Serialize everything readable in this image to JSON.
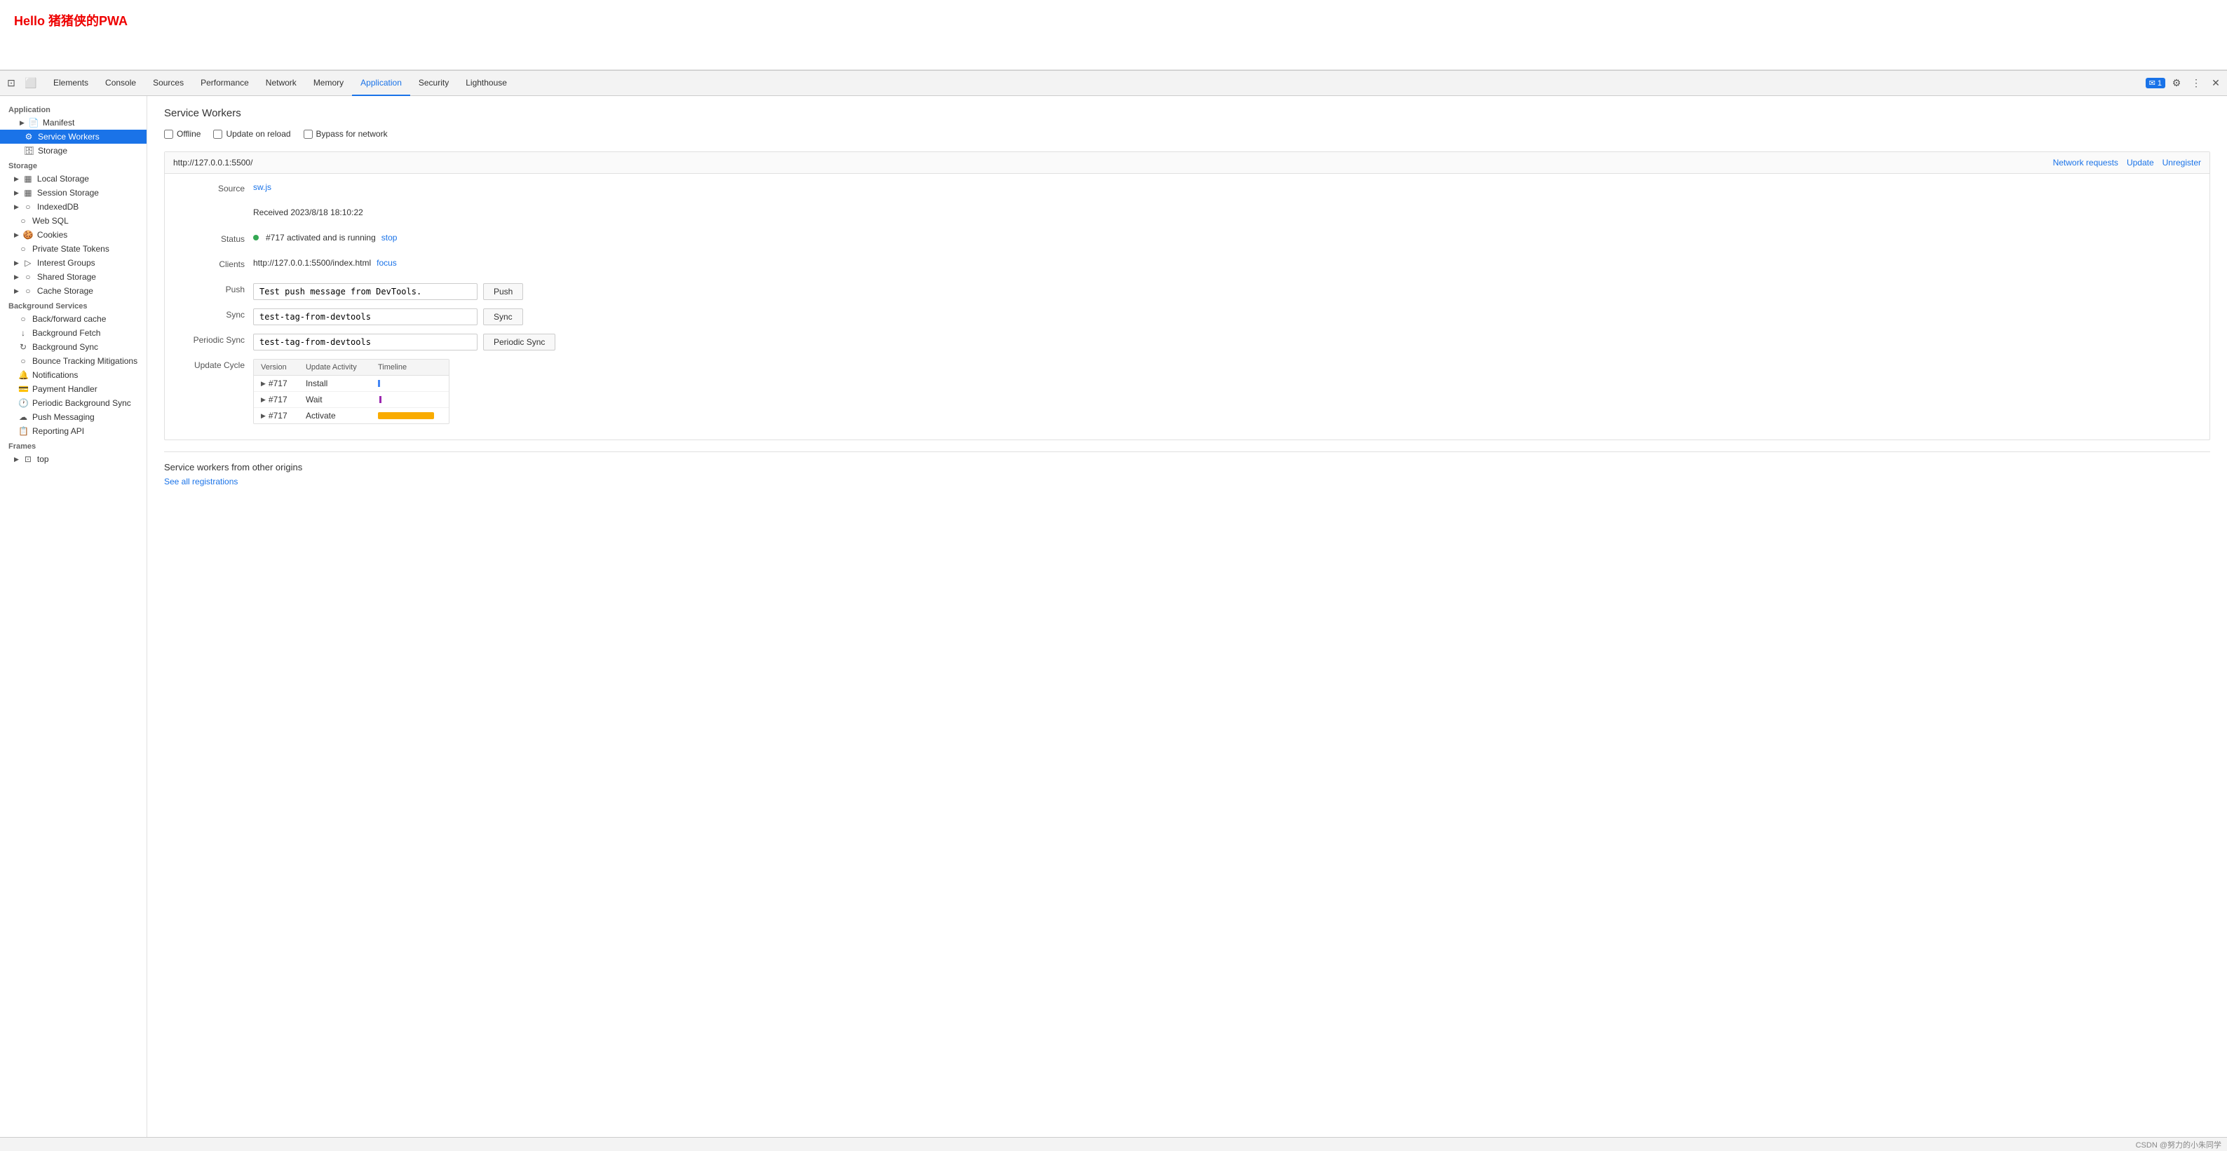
{
  "page": {
    "title": "Hello 猪猪侠的PWA"
  },
  "devtools": {
    "tabs": [
      {
        "id": "elements",
        "label": "Elements",
        "active": false
      },
      {
        "id": "console",
        "label": "Console",
        "active": false
      },
      {
        "id": "sources",
        "label": "Sources",
        "active": false
      },
      {
        "id": "performance",
        "label": "Performance",
        "active": false
      },
      {
        "id": "network",
        "label": "Network",
        "active": false
      },
      {
        "id": "memory",
        "label": "Memory",
        "active": false
      },
      {
        "id": "application",
        "label": "Application",
        "active": true
      },
      {
        "id": "security",
        "label": "Security",
        "active": false
      },
      {
        "id": "lighthouse",
        "label": "Lighthouse",
        "active": false
      }
    ],
    "notification_count": "1",
    "sidebar": {
      "section_application": "Application",
      "section_storage": "Storage",
      "section_background": "Background Services",
      "section_frames": "Frames",
      "items_application": [
        {
          "id": "manifest",
          "label": "Manifest",
          "icon": "📄",
          "indent": true
        },
        {
          "id": "service-workers",
          "label": "Service Workers",
          "icon": "⚙",
          "active": true,
          "indent": true
        },
        {
          "id": "storage-app",
          "label": "Storage",
          "icon": "🗄",
          "indent": true
        }
      ],
      "items_storage": [
        {
          "id": "local-storage",
          "label": "Local Storage",
          "icon": "▦",
          "expand": true
        },
        {
          "id": "session-storage",
          "label": "Session Storage",
          "icon": "▦",
          "expand": true
        },
        {
          "id": "indexed-db",
          "label": "IndexedDB",
          "icon": "○"
        },
        {
          "id": "web-sql",
          "label": "Web SQL",
          "icon": "○"
        },
        {
          "id": "cookies",
          "label": "Cookies",
          "icon": "🍪",
          "expand": true
        },
        {
          "id": "private-state-tokens",
          "label": "Private State Tokens",
          "icon": "○"
        },
        {
          "id": "interest-groups",
          "label": "Interest Groups",
          "icon": "▷",
          "expand": true
        },
        {
          "id": "shared-storage",
          "label": "Shared Storage",
          "icon": "○",
          "expand": true
        },
        {
          "id": "cache-storage",
          "label": "Cache Storage",
          "icon": "○",
          "expand": true
        }
      ],
      "items_background": [
        {
          "id": "back-forward-cache",
          "label": "Back/forward cache",
          "icon": "○"
        },
        {
          "id": "background-fetch",
          "label": "Background Fetch",
          "icon": "↓"
        },
        {
          "id": "background-sync",
          "label": "Background Sync",
          "icon": "↻"
        },
        {
          "id": "bounce-tracking",
          "label": "Bounce Tracking Mitigations",
          "icon": "○"
        },
        {
          "id": "notifications",
          "label": "Notifications",
          "icon": "🔔"
        },
        {
          "id": "payment-handler",
          "label": "Payment Handler",
          "icon": "💳"
        },
        {
          "id": "periodic-bg-sync",
          "label": "Periodic Background Sync",
          "icon": "🕐"
        },
        {
          "id": "push-messaging",
          "label": "Push Messaging",
          "icon": "☁"
        },
        {
          "id": "reporting-api",
          "label": "Reporting API",
          "icon": "📋"
        }
      ]
    },
    "content": {
      "section_title": "Service Workers",
      "checkboxes": [
        {
          "id": "offline",
          "label": "Offline",
          "checked": false
        },
        {
          "id": "update-on-reload",
          "label": "Update on reload",
          "checked": false
        },
        {
          "id": "bypass-for-network",
          "label": "Bypass for network",
          "checked": false
        }
      ],
      "sw_entry": {
        "url": "http://127.0.0.1:5500/",
        "actions": [
          {
            "id": "network-requests",
            "label": "Network requests"
          },
          {
            "id": "update",
            "label": "Update"
          },
          {
            "id": "unregister",
            "label": "Unregister"
          }
        ],
        "rows": {
          "source_label": "Source",
          "source_link": "sw.js",
          "received_label": "",
          "received_value": "Received 2023/8/18 18:10:22",
          "status_label": "Status",
          "status_dot": "green",
          "status_text": "#717 activated and is running",
          "status_action": "stop",
          "clients_label": "Clients",
          "clients_value": "http://127.0.0.1:5500/index.html",
          "clients_action": "focus",
          "push_label": "Push",
          "push_value": "Test push message from DevTools.",
          "push_button": "Push",
          "sync_label": "Sync",
          "sync_value": "test-tag-from-devtools",
          "sync_button": "Sync",
          "periodic_sync_label": "Periodic Sync",
          "periodic_sync_value": "test-tag-from-devtools",
          "periodic_sync_button": "Periodic Sync",
          "update_cycle_label": "Update Cycle"
        },
        "update_cycle": {
          "columns": [
            "Version",
            "Update Activity",
            "Timeline"
          ],
          "rows": [
            {
              "version": "#717",
              "activity": "Install",
              "timeline": "blue"
            },
            {
              "version": "#717",
              "activity": "Wait",
              "timeline": "purple"
            },
            {
              "version": "#717",
              "activity": "Activate",
              "timeline": "orange"
            }
          ]
        }
      },
      "other_origins": {
        "title": "Service workers from other origins",
        "link": "See all registrations"
      }
    }
  },
  "bottom_bar": {
    "attribution": "CSDN @努力的小朱同学"
  }
}
